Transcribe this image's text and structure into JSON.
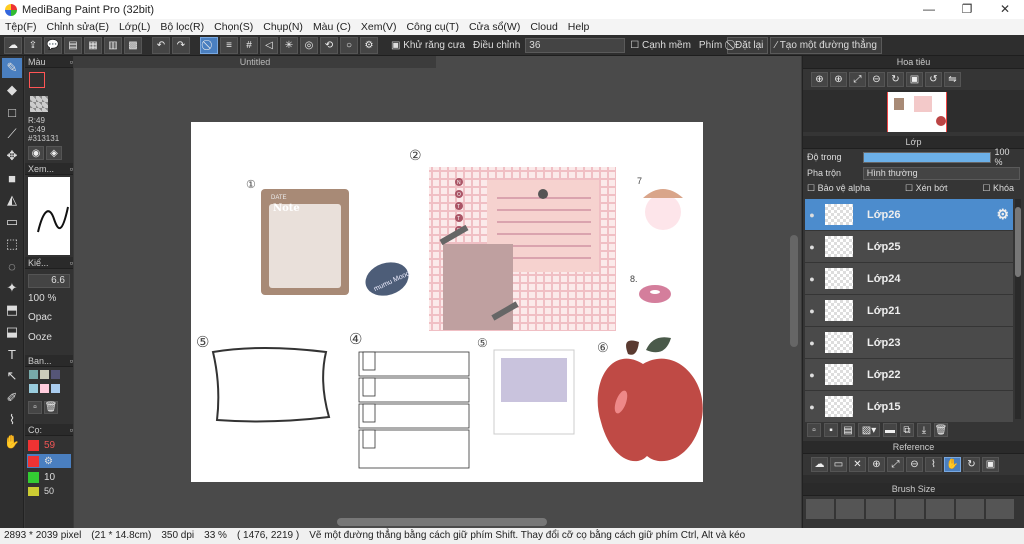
{
  "app": {
    "title": "MediBang Paint Pro (32bit)"
  },
  "menu": [
    "Tệp(F)",
    "Chỉnh sửa(E)",
    "Lớp(L)",
    "Bộ lọc(R)",
    "Chọn(S)",
    "Chụp(N)",
    "Màu (C)",
    "Xem(V)",
    "Công cụ(T)",
    "Cửa sổ(W)",
    "Cloud",
    "Help"
  ],
  "toolbar": {
    "antialias_label": "Khử răng cưa",
    "adjust_label": "Điều chỉnh",
    "adjust_value": "36",
    "smooth_edge_label": "Cạnh mềm",
    "key_label": "Phím",
    "reset_label": "Đặt lại",
    "line_label": "Tạo một đường thẳng"
  },
  "color_panel": {
    "title": "Màu",
    "r": "R:49",
    "g": "G:49",
    "hex": "#313131",
    "primary": "#313131"
  },
  "preview_panel": {
    "title": "Xem..."
  },
  "brush_panel": {
    "title": "Kiể...",
    "size": "6.6",
    "opacity_value": "100 %",
    "opacity_label": "Opac",
    "ooze_label": "Ooze"
  },
  "palette_panel": {
    "title": "Ban..."
  },
  "brushes_panel": {
    "title": "Cọ:",
    "items": [
      "59",
      "",
      "10",
      "50"
    ]
  },
  "document": {
    "tab": "Untitled"
  },
  "navigator": {
    "title": "Hoa tiêu"
  },
  "layer_panel": {
    "title": "Lớp",
    "opacity_label": "Độ trong",
    "opacity_value": "100 %",
    "opacity_fraction": 1.0,
    "blend_label": "Pha trộn",
    "blend_value": "Hình thường",
    "protect_alpha": "Bảo vệ alpha",
    "clip": "Xén bớt",
    "lock": "Khóa",
    "layers": [
      "Lớp26",
      "Lớp25",
      "Lớp24",
      "Lớp21",
      "Lớp23",
      "Lớp22",
      "Lớp15"
    ]
  },
  "reference_panel": {
    "title": "Reference"
  },
  "brush_size_panel": {
    "title": "Brush Size"
  },
  "canvas_labels": {
    "n1": "①",
    "n2": "②",
    "n5": "⑤",
    "n4": "④",
    "n5b": "⑤",
    "n6": "⑥",
    "n7": "7",
    "n8": "8.",
    "note": "Note",
    "date": "DATE",
    "mumu": "mumu Mood",
    "notte": [
      "N",
      "O",
      "T",
      "T",
      "E"
    ]
  },
  "status": {
    "size": "2893 * 2039 pixel",
    "cm": "(21 * 14.8cm)",
    "dpi": "350 dpi",
    "zoom": "33 %",
    "coords": "( 1476, 2219 )",
    "hint": "Vẽ một đường thẳng bằng cách giữ phím Shift. Thay đổi cỡ cọ bằng cách giữ phím Ctrl, Alt và kéo"
  }
}
